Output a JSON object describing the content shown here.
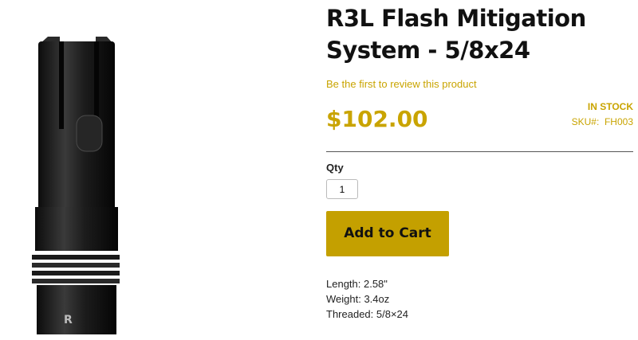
{
  "product": {
    "title": "R3L Flash Mitigation System - 5/8x24",
    "review_link": "Be the first to review this product",
    "price": "$102.00",
    "stock_status": "IN STOCK",
    "sku_label": "SKU#:",
    "sku_value": "FH003",
    "qty_label": "Qty",
    "qty_value": "1",
    "add_to_cart_label": "Add to Cart",
    "specs": [
      "Length: 2.58\"",
      "Weight: 3.4oz",
      "Threaded: 5/8×24"
    ]
  },
  "colors": {
    "accent": "#c9a400",
    "button": "#c4a000"
  },
  "icons": {
    "product_image": "flash-hider-image"
  }
}
